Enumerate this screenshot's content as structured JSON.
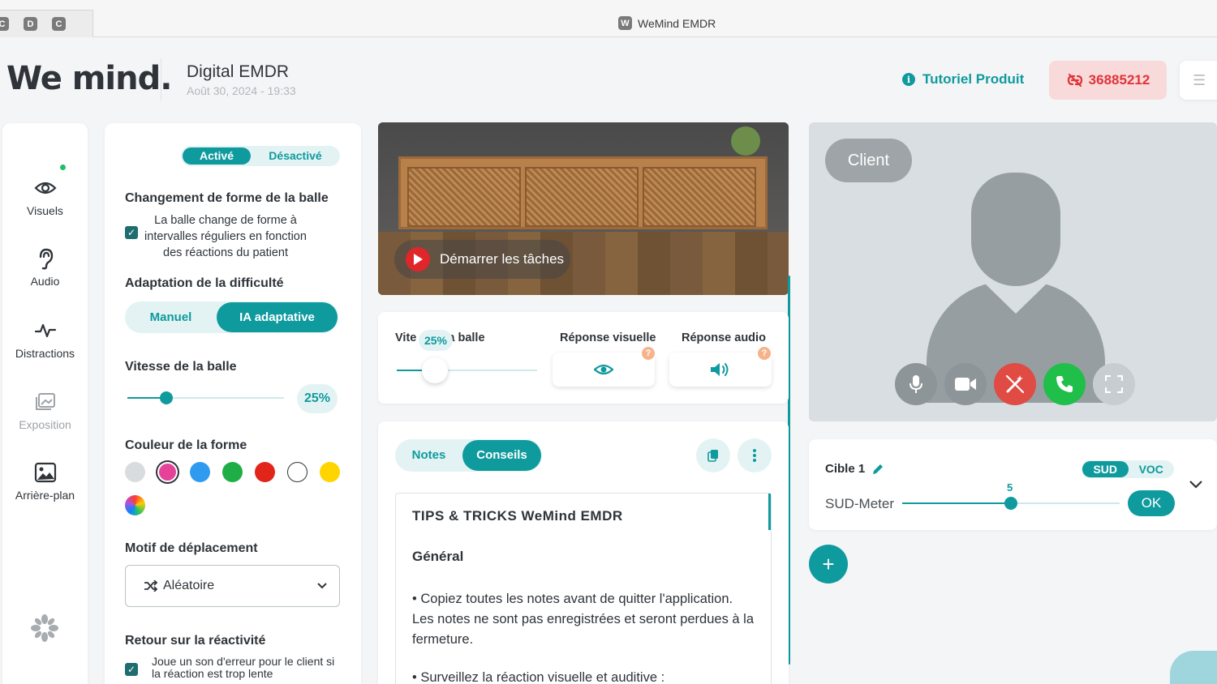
{
  "window": {
    "tabs": [
      "C",
      "D",
      "C"
    ],
    "logo_letter": "W",
    "title": "WeMind EMDR"
  },
  "header": {
    "logo": "We mind.",
    "session_title": "Digital EMDR",
    "session_date": "Août 30, 2024 - 19:33",
    "tutorial_label": "Tutoriel Produit",
    "session_code": "36885212"
  },
  "nav": {
    "items": [
      {
        "label": "Visuels",
        "icon": "eye-icon"
      },
      {
        "label": "Audio",
        "icon": "ear-icon"
      },
      {
        "label": "Distractions",
        "icon": "pulse-icon"
      },
      {
        "label": "Exposition",
        "icon": "gallery-icon"
      },
      {
        "label": "Arrière-plan",
        "icon": "image-icon"
      }
    ]
  },
  "settings": {
    "toggle_on": "Activé",
    "toggle_off": "Désactivé",
    "shape_change_title": "Changement de forme de la balle",
    "shape_change_desc_1": "La balle change de forme à",
    "shape_change_desc_2": "intervalles réguliers en fonction",
    "shape_change_desc_3": "des réactions du patient",
    "shape_change_checked": true,
    "difficulty_title": "Adaptation de la difficulté",
    "difficulty_manual": "Manuel",
    "difficulty_ai": "IA adaptative",
    "speed_title": "Vitesse de la balle",
    "speed_value": "25%",
    "speed_fraction": 0.25,
    "color_title": "Couleur de la forme",
    "colors": [
      "#d9dcde",
      "#e5429a",
      "#2f9bf0",
      "#1fae45",
      "#e1251b",
      "#ffffff",
      "#ffd500"
    ],
    "selected_color_index": 1,
    "motion_title": "Motif de déplacement",
    "motion_value": "Aléatoire",
    "feedback_title": "Retour sur la réactivité",
    "feedback_desc_1": "Joue un son d'erreur pour le client si",
    "feedback_desc_2": "la réaction est trop lente",
    "feedback_checked": true
  },
  "video": {
    "start_label": "Démarrer les tâches"
  },
  "controls": {
    "speed_label_start": "Vite",
    "speed_label_end": "la balle",
    "speed_tooltip": "25%",
    "visual_response_label": "Réponse visuelle",
    "audio_response_label": "Réponse audio",
    "help": "?"
  },
  "notes": {
    "tab_notes": "Notes",
    "tab_tips": "Conseils",
    "heading": "TIPS & TRICKS WeMind EMDR",
    "subheading": "Général",
    "p1": "• Copiez toutes les notes avant de quitter l'application. Les notes ne sont pas enregistrées et seront perdues à la fermeture.",
    "p2": "• Surveillez la réaction visuelle et auditive :"
  },
  "client": {
    "label": "Client"
  },
  "sud": {
    "target_label": "Cible 1",
    "toggle_sud": "SUD",
    "toggle_voc": "VOC",
    "meter_label": "SUD-Meter",
    "meter_value": "5",
    "meter_fraction": 0.5,
    "ok_label": "OK"
  },
  "colors": {
    "accent": "#0f9a9e",
    "danger": "#e0343a",
    "call_green": "#1fbf4a"
  }
}
